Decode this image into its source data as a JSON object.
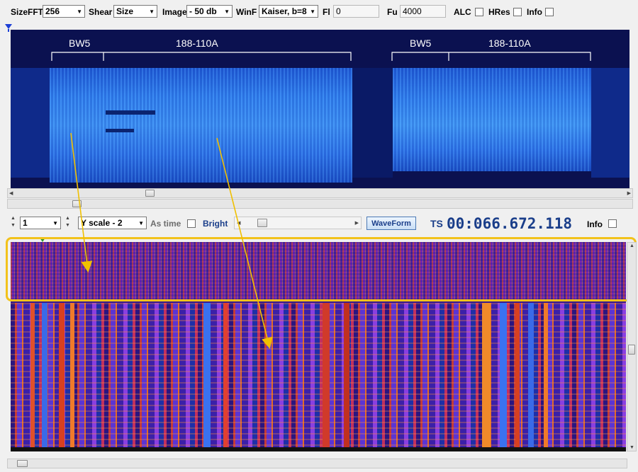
{
  "toolbar": {
    "sizefft_label": "SizeFFT",
    "sizefft_value": "256",
    "shear_label": "Shear",
    "shear_value": "Size",
    "image_label": "Image",
    "image_value": "- 50 db",
    "winf_label": "WinF",
    "winf_value": "Kaiser, b=8",
    "fl_label": "Fl",
    "fl_value": "0",
    "fu_label": "Fu",
    "fu_value": "4000",
    "alc_label": "ALC",
    "hres_label": "HRes",
    "info_label": "Info"
  },
  "upper_spectrogram": {
    "annotations": {
      "left_a": "BW5",
      "left_b": "188-110A",
      "right_a": "BW5",
      "right_b": "188-110A"
    }
  },
  "middle_bar": {
    "spin_value": "1",
    "yscale_value": "Y scale - 2",
    "astime_label": "As time",
    "bright_label": "Bright",
    "waveform_label": "WaveForm",
    "ts_label": "TS",
    "ts_value": "00:066.672.118",
    "info_label": "Info"
  },
  "colors": {
    "highlight": "#f2c21b",
    "arrow": "#f0c000",
    "waveform_text": "#1a3e8a",
    "ts_text": "#1a3e8a"
  }
}
